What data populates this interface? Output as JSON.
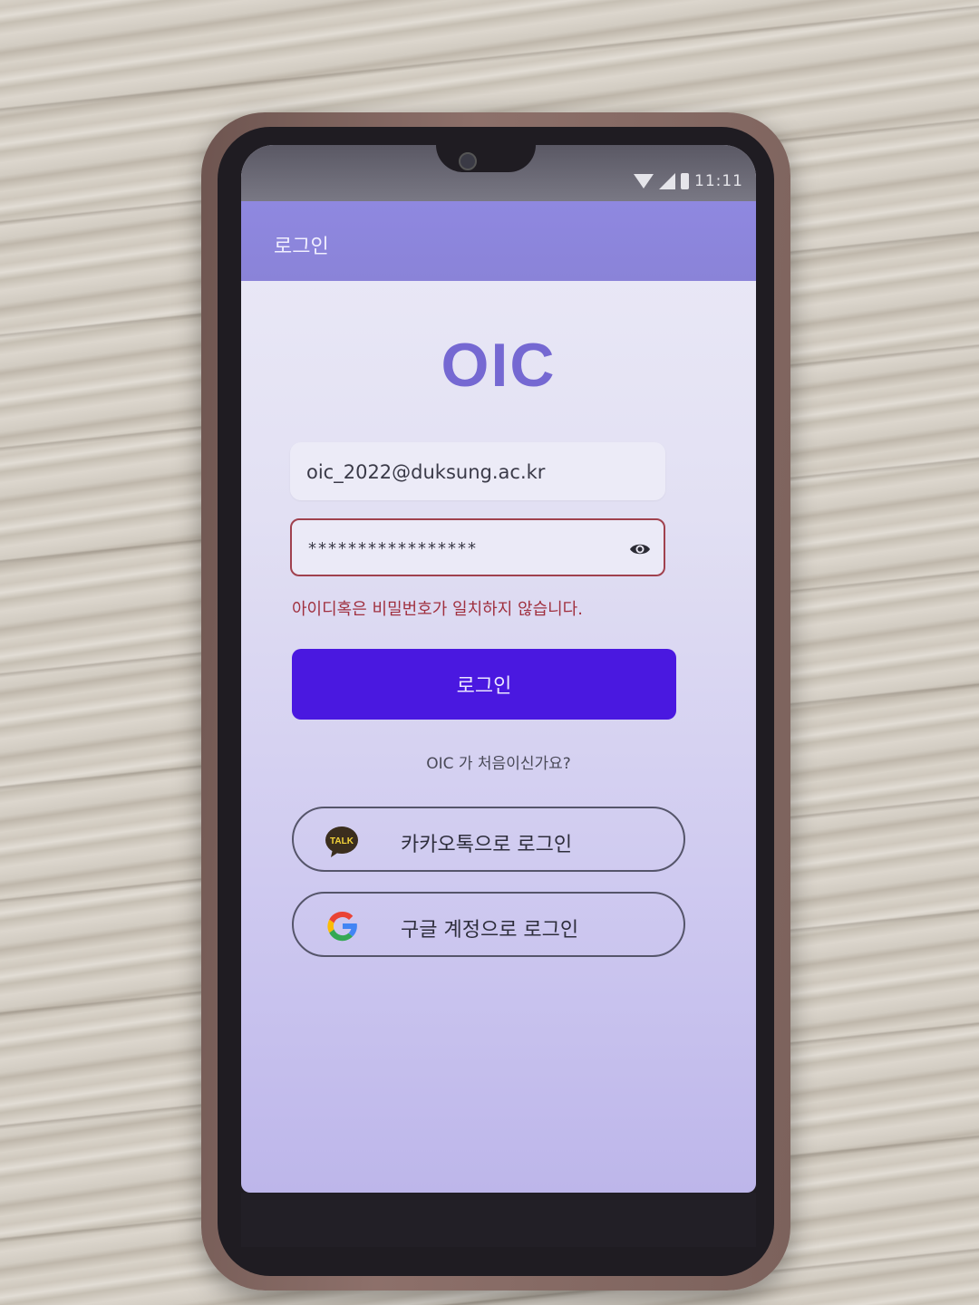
{
  "status_bar": {
    "time": "11:11",
    "icons": [
      "wifi-icon",
      "signal-icon",
      "battery-icon"
    ]
  },
  "app_bar": {
    "title": "로그인"
  },
  "logo": {
    "text": "OIC"
  },
  "login_form": {
    "email_value": "oic_2022@duksung.ac.kr",
    "password_value": "*****************",
    "error_message": "아이디혹은 비밀번호가 일치하지 않습니다.",
    "login_button_label": "로그인",
    "first_time_text": "OIC 가 처음이신가요?"
  },
  "social_login": {
    "kakao_label": "카카오톡으로 로그인",
    "kakao_icon_text": "TALK",
    "google_label": "구글 계정으로 로그인"
  },
  "colors": {
    "primary": "#4a18e0",
    "app_bar": "#8f88e0",
    "logo": "#7568d2",
    "error": "#a0303f",
    "kakao_bubble": "#3b2e1e"
  }
}
